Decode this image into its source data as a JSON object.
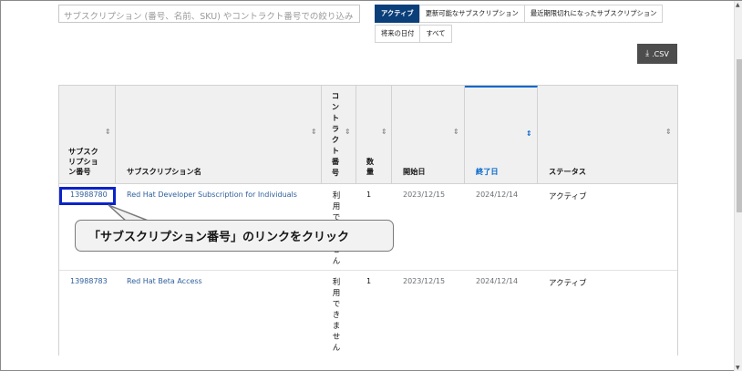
{
  "search": {
    "placeholder": "サブスクリプション (番号、名前、SKU) やコントラクト番号での絞り込み"
  },
  "filters": {
    "row1": [
      "アクティブ",
      "更新可能なサブスクリプション",
      "最近期限切れになったサブスクリプション"
    ],
    "row2": [
      "将来の日付",
      "すべて"
    ],
    "active_index": 0
  },
  "csv_button": {
    "label": ".CSV",
    "icon": "download-icon"
  },
  "table": {
    "headers": {
      "number": "サブスクリプション番号",
      "name": "サブスクリプション名",
      "contract": "コントラクト番号",
      "quantity": "数量",
      "start": "開始日",
      "end": "終了日",
      "status": "ステータス"
    },
    "sorted_column": "end",
    "rows": [
      {
        "number": "13988780",
        "name": "Red Hat Developer Subscription for Individuals",
        "contract": "利用できません",
        "quantity": "1",
        "start": "2023/12/15",
        "end": "2024/12/14",
        "status": "アクティブ"
      },
      {
        "number": "13988783",
        "name": "Red Hat Beta Access",
        "contract": "利用できません",
        "quantity": "1",
        "start": "2023/12/15",
        "end": "2024/12/14",
        "status": "アクティブ"
      }
    ]
  },
  "callout": {
    "text": "「サブスクリプション番号」のリンクをクリック"
  },
  "colors": {
    "active_tab": "#0b3f7a",
    "link": "#2f5f9c",
    "highlight": "#0a23c9",
    "sorted": "#0066cc"
  }
}
